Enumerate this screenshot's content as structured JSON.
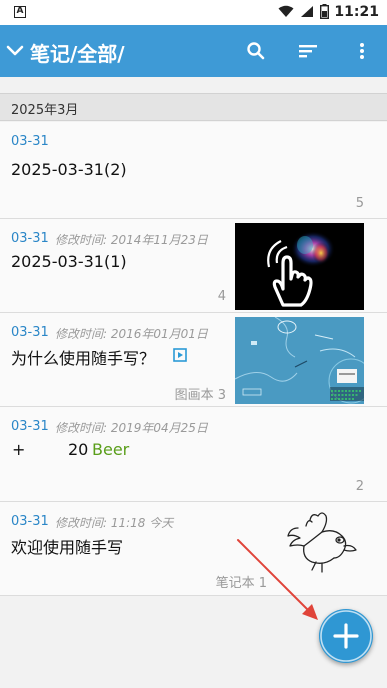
{
  "status_bar": {
    "time": "11:21",
    "notif_letter": "A"
  },
  "app_bar": {
    "title": "笔记/全部/"
  },
  "month_header": "2025年3月",
  "notes": [
    {
      "date": "03-31",
      "modified": "",
      "title": "2025-03-31(2)",
      "count": "5"
    },
    {
      "date": "03-31",
      "modified": "修改时间: 2014年11月23日",
      "title": "2025-03-31(1)",
      "count": "4"
    },
    {
      "date": "03-31",
      "modified": "修改时间: 2016年01月01日",
      "title": "为什么使用随手写？",
      "count": "图画本 3"
    },
    {
      "date": "03-31",
      "modified": "修改时间: 2019年04月25日",
      "title_prefix": "+",
      "title_number": "20",
      "title_word": "Beer",
      "count": "2"
    },
    {
      "date": "03-31",
      "modified": "修改时间: 11:18 今天",
      "title": "欢迎使用随手写",
      "count": "笔记本 1"
    }
  ],
  "colors": {
    "accent": "#3e9ad6",
    "date": "#2a86c7",
    "beer": "#5a9e1a",
    "arrow": "#e0443a"
  },
  "icons": [
    "search-icon",
    "sort-icon",
    "more-vert-icon",
    "chevron-down-icon",
    "add-icon",
    "play-icon"
  ]
}
